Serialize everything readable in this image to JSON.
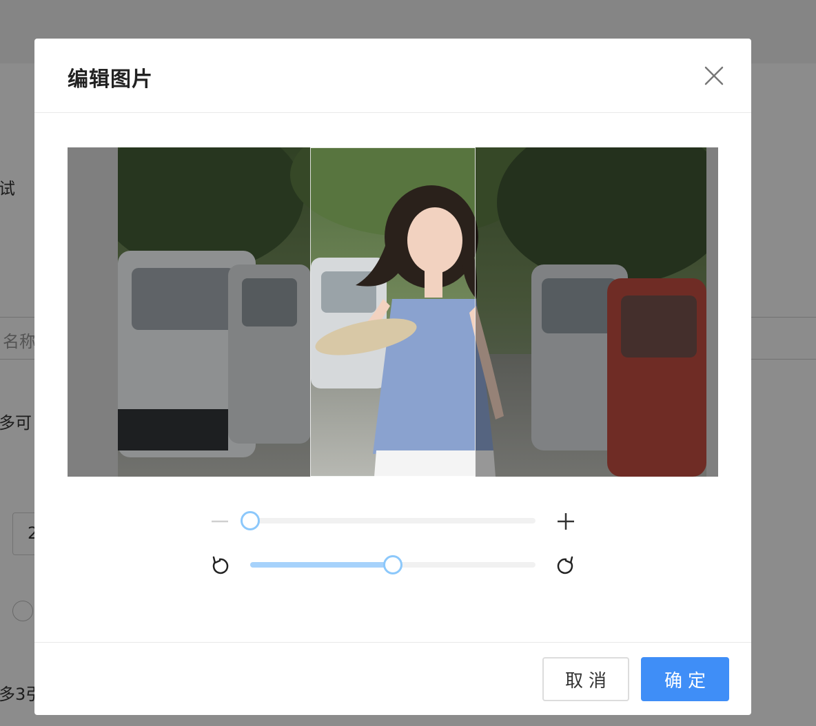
{
  "background": {
    "fragment_1": "试",
    "input_placeholder": "名称",
    "fragment_2": "多可",
    "number_value": "2",
    "fragment_3": "多3引"
  },
  "dialog": {
    "title": "编辑图片",
    "close_icon": "close-icon",
    "image_description": "photo-woman-blue-top-street",
    "zoom": {
      "minus_icon": "minus-icon",
      "plus_icon": "plus-icon",
      "value": 0.0
    },
    "rotate": {
      "left_icon": "rotate-left-icon",
      "right_icon": "rotate-right-icon",
      "value": 0.5
    },
    "footer": {
      "cancel_label": "取消",
      "ok_label": "确定"
    }
  },
  "colors": {
    "primary": "#3f8ef7",
    "slider_fill": "#a6d2fb",
    "slider_thumb_border": "#8cc8fb"
  }
}
